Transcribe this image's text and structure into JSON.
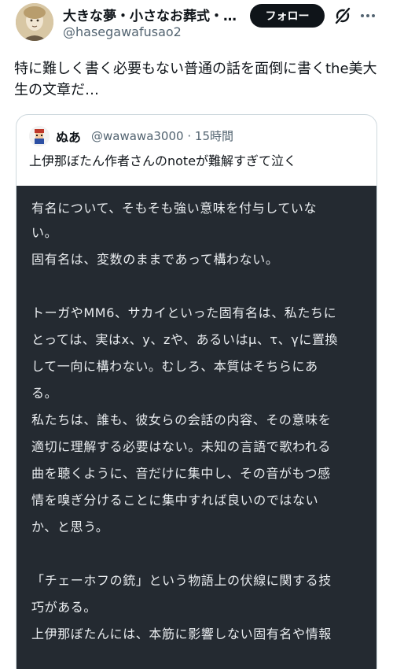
{
  "post": {
    "author_name": "大きな夢・小さなお葬式・…",
    "author_handle": "@hasegawafusao2",
    "follow_label": "フォロー",
    "text": "特に難しく書く必要もない普通の話を面倒に書くthe美大生の文章だ…"
  },
  "icons": {
    "grok": "grok-icon",
    "more": "more-icon"
  },
  "quote": {
    "author_name": "ぬあ",
    "author_handle": "@wawawa3000",
    "separator": "·",
    "time": "15時間",
    "text": "上伊那ぼたん作者さんのnoteが難解すぎて泣く",
    "image_lines": [
      "有名について、そもそも強い意味を付与していな",
      "い。",
      "固有名は、変数のままであって構わない。",
      "",
      "トーガやMM6、サカイといった固有名は、私たちに",
      "とっては、実はx、y、zや、あるいはμ、τ、γに置換",
      "して一向に構わない。むしろ、本質はそちらにあ",
      "る。",
      "私たちは、誰も、彼女らの会話の内容、その意味を",
      "適切に理解する必要はない。未知の言語で歌われる",
      "曲を聴くように、音だけに集中し、その音がもつ感",
      "情を嗅ぎ分けることに集中すれば良いのではない",
      "か、と思う。",
      "",
      "「チェーホフの銃」という物語上の伏線に関する技",
      "巧がある。",
      "上伊那ぼたんには、本筋に影響しない固有名や情報"
    ]
  }
}
